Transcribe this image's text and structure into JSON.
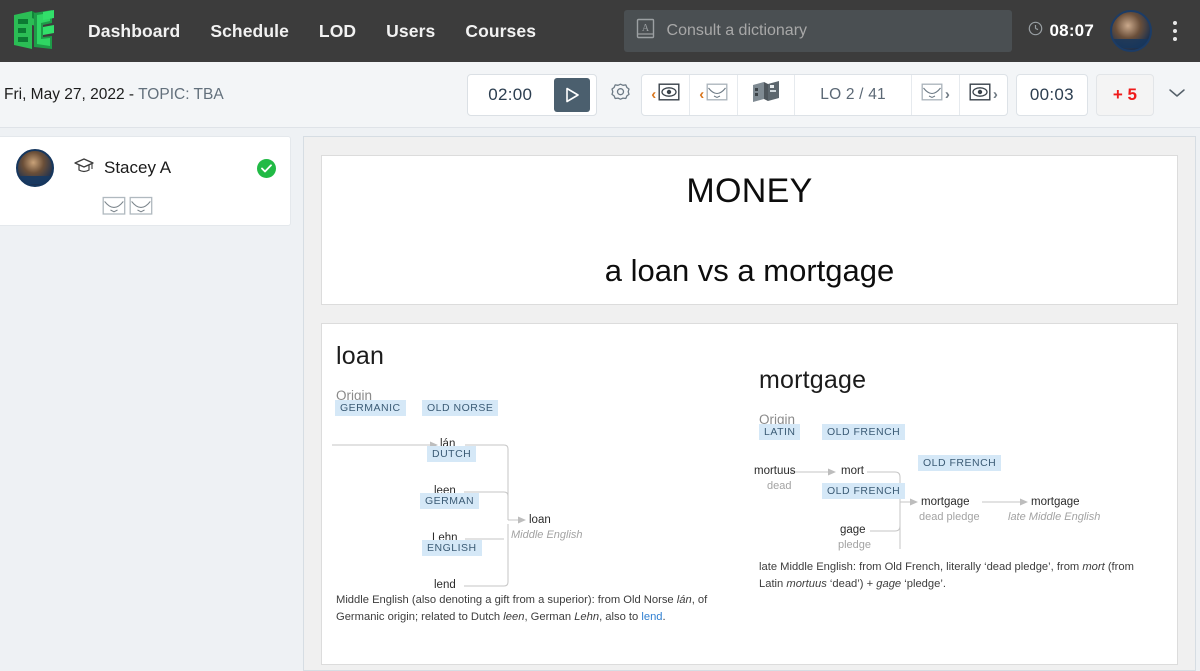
{
  "header": {
    "logo_icon": "elc-cube-logo",
    "nav": [
      {
        "label": "Dashboard"
      },
      {
        "label": "Schedule"
      },
      {
        "label": "LOD"
      },
      {
        "label": "Users"
      },
      {
        "label": "Courses"
      }
    ],
    "search": {
      "icon": "dictionary-icon",
      "placeholder": "Consult a dictionary",
      "value": ""
    },
    "clock": {
      "icon": "clock-icon",
      "time": "08:07"
    },
    "avatar_icon": "user-avatar",
    "menu_icon": "kebab-menu-icon",
    "bg_color": "#3c3c3c"
  },
  "toolbar": {
    "date": "Fri, May 27, 2022",
    "separator": " - ",
    "topic": "TOPIC: TBA",
    "timer_value": "02:00",
    "play_icon": "play-icon",
    "settings_icon": "gear-icon",
    "prev_eye": {
      "chevron": "‹",
      "icon": "eye-box-icon"
    },
    "prev_card": {
      "chevron": "‹",
      "icon": "card-box-icon"
    },
    "book_icon": "open-book-icon",
    "lo_counter": "LO 2 / 41",
    "next_card": {
      "icon": "card-box-icon",
      "chevron": "›"
    },
    "next_eye": {
      "icon": "eye-box-icon",
      "chevron": "›"
    },
    "elapsed": "00:03",
    "add_time": "+ 5",
    "add_time_color": "#ef1b1b",
    "expand_icon": "chevron-down-icon"
  },
  "sidebar": {
    "students": [
      {
        "avatar_icon": "student-avatar",
        "cap_icon": "graduation-cap-icon",
        "name": "Stacey A",
        "status_icon": "check-circle-icon",
        "status_color": "#21ba45",
        "action_icons": [
          "card-box-icon",
          "card-box-icon"
        ]
      }
    ]
  },
  "slide": {
    "title": "MONEY",
    "subtitle": "a loan vs a mortgage",
    "etymology": {
      "loan": {
        "word": "loan",
        "origin_label": "Origin",
        "nodes": [
          {
            "tag": "GERMANIC",
            "term": "",
            "gloss": ""
          },
          {
            "tag": "OLD NORSE",
            "term": "lán",
            "gloss": ""
          },
          {
            "tag": "DUTCH",
            "term": "leen",
            "gloss": ""
          },
          {
            "tag": "GERMAN",
            "term": "Lehn",
            "gloss": ""
          },
          {
            "tag": "ENGLISH",
            "term": "lend",
            "gloss": ""
          }
        ],
        "result": {
          "term": "loan",
          "gloss": "Middle English"
        },
        "note_parts": [
          {
            "text": "Middle English (also denoting a gift from a superior): from Old Norse ",
            "style": "normal"
          },
          {
            "text": "lán",
            "style": "italic"
          },
          {
            "text": ", of Germanic origin; related to Dutch ",
            "style": "normal"
          },
          {
            "text": "leen",
            "style": "italic"
          },
          {
            "text": ", German ",
            "style": "normal"
          },
          {
            "text": "Lehn",
            "style": "italic"
          },
          {
            "text": ", also to ",
            "style": "normal"
          },
          {
            "text": "lend",
            "style": "link"
          },
          {
            "text": ".",
            "style": "normal"
          }
        ]
      },
      "mortgage": {
        "word": "mortgage",
        "origin_label": "Origin",
        "nodes": [
          {
            "tag": "LATIN",
            "term": "mortuus",
            "gloss": "dead"
          },
          {
            "tag": "OLD FRENCH",
            "term": "mort",
            "gloss": ""
          },
          {
            "tag": "OLD FRENCH",
            "term": "gage",
            "gloss": "pledge"
          },
          {
            "tag": "OLD FRENCH",
            "term": "mortgage",
            "gloss": "dead pledge"
          }
        ],
        "result": {
          "term": "mortgage",
          "gloss": "late Middle English"
        },
        "note_parts": [
          {
            "text": "late Middle English: from Old French, literally ‘dead pledge’, from ",
            "style": "normal"
          },
          {
            "text": "mort",
            "style": "italic"
          },
          {
            "text": " (from Latin ",
            "style": "normal"
          },
          {
            "text": "mortuus",
            "style": "italic"
          },
          {
            "text": " ‘dead’) + ",
            "style": "normal"
          },
          {
            "text": "gage",
            "style": "italic"
          },
          {
            "text": " ‘pledge’.",
            "style": "normal"
          }
        ]
      }
    }
  }
}
